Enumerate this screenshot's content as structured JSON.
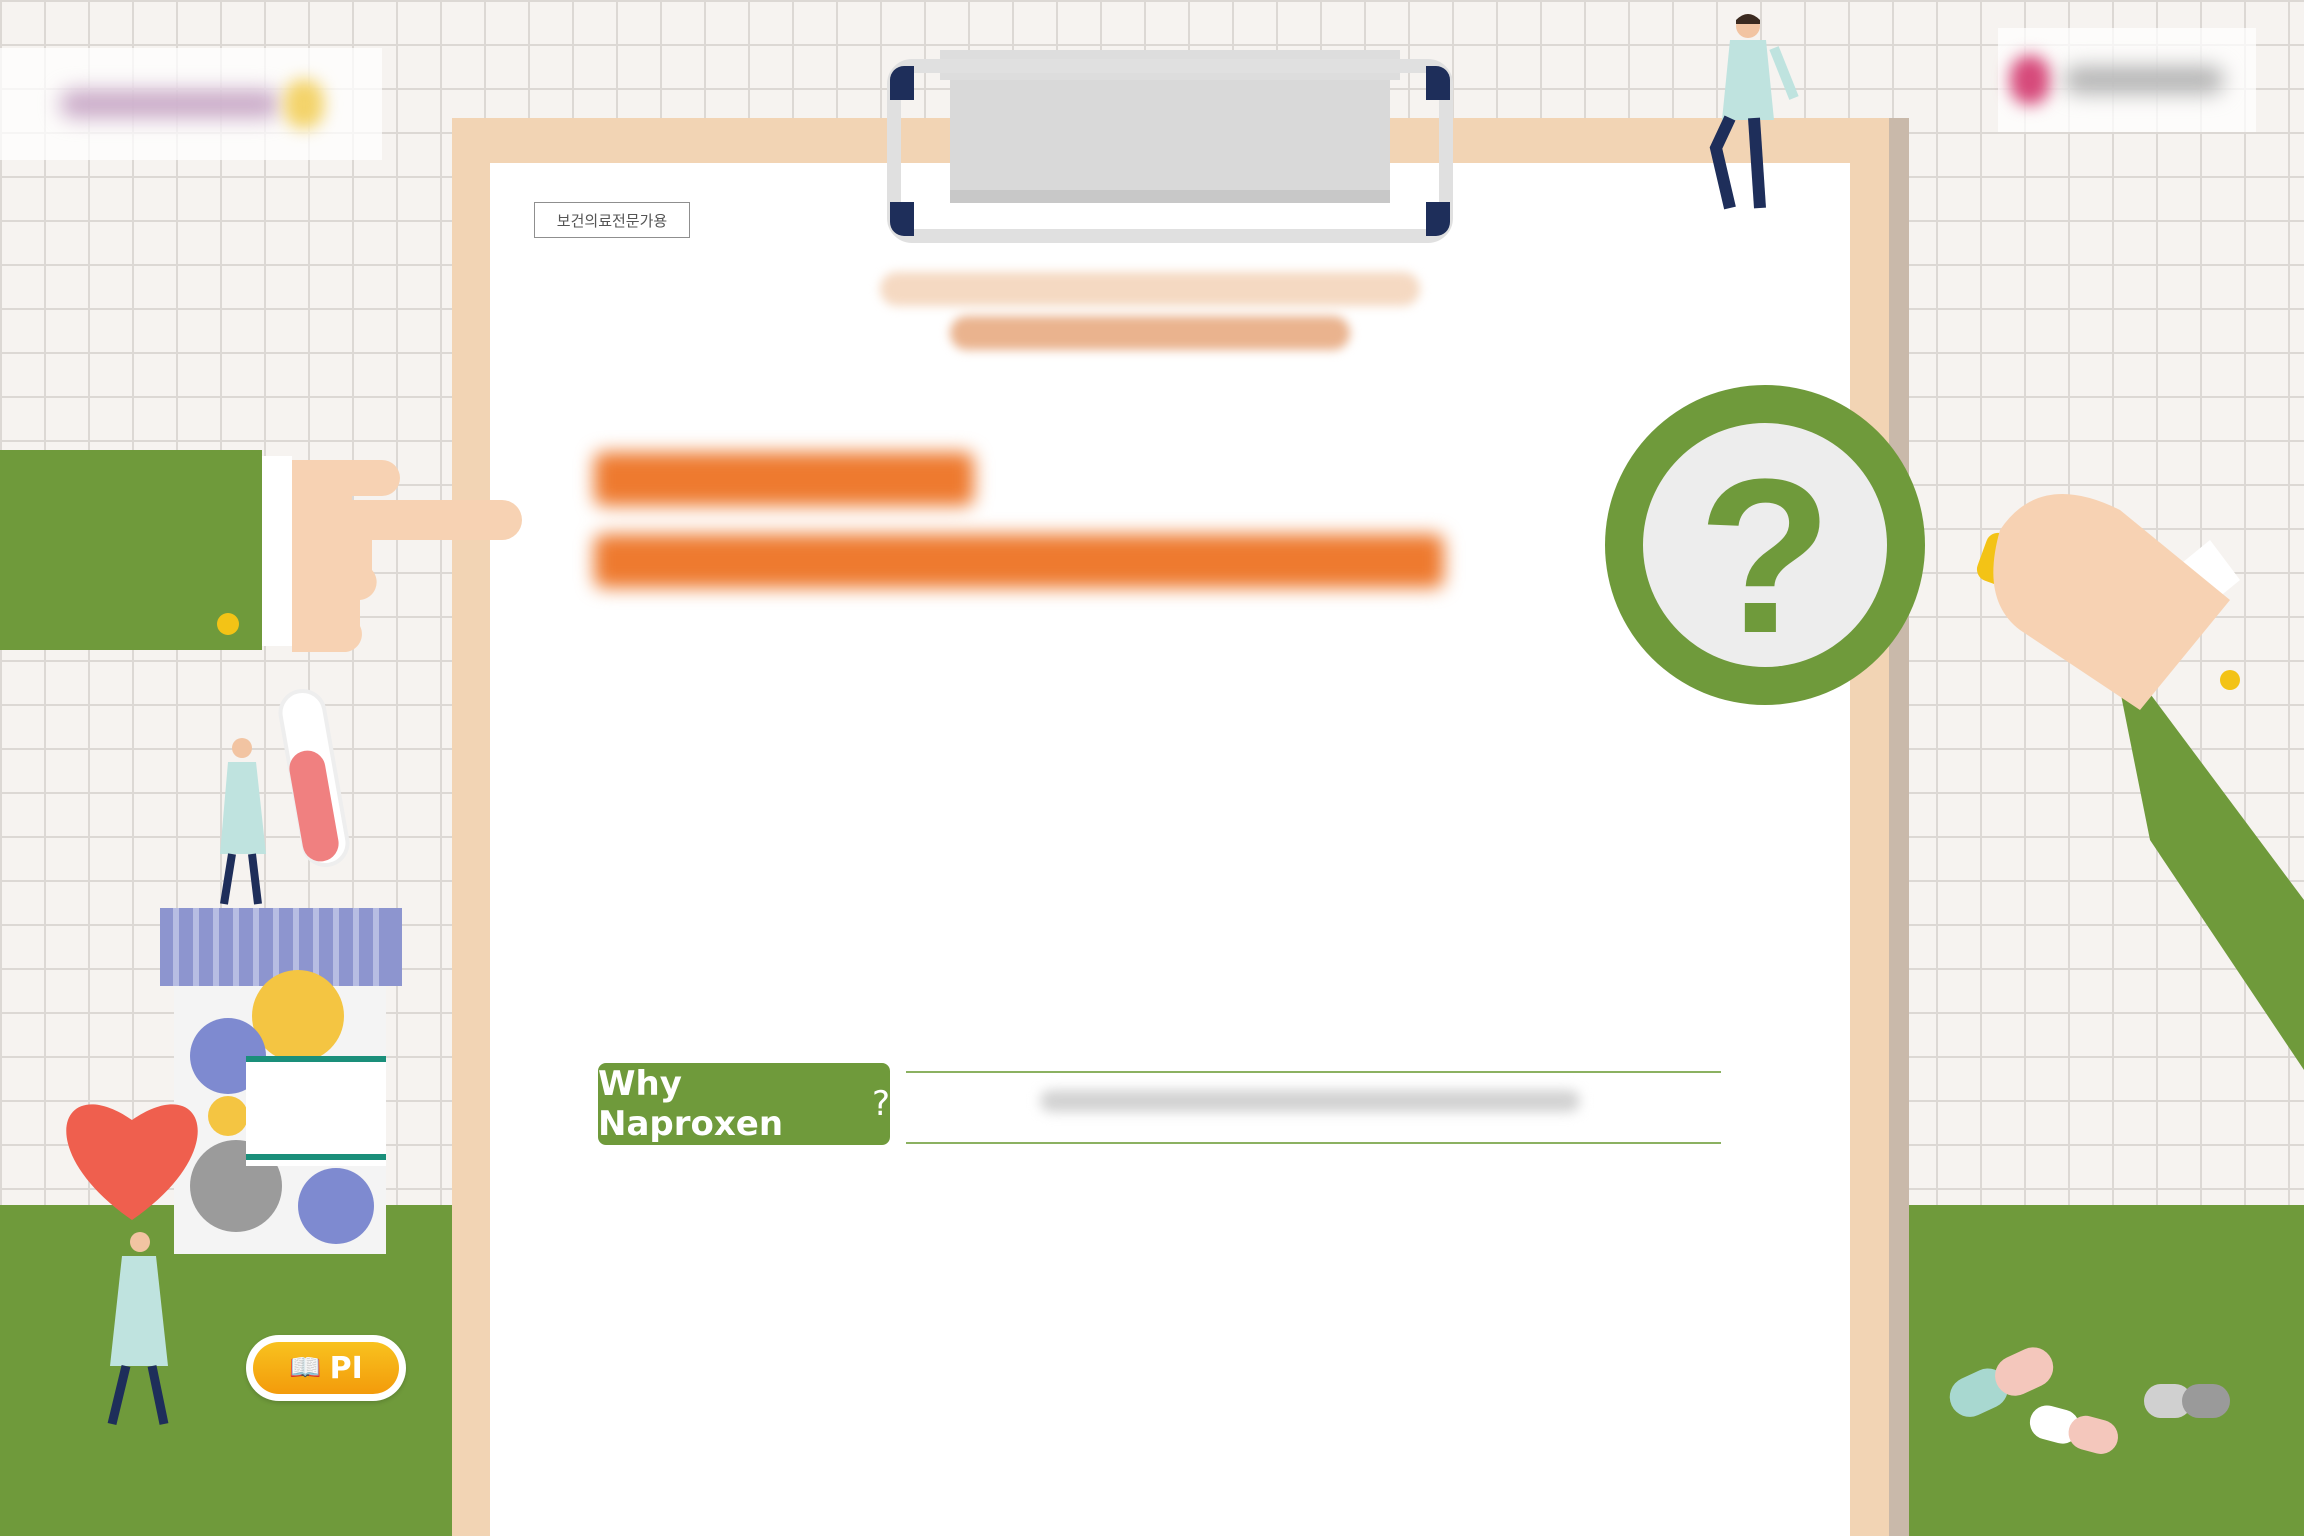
{
  "page": {
    "badge_label": "보건의료전문가용",
    "why_tag": {
      "main": "Why Naproxen",
      "mark": "?"
    },
    "pi_button": {
      "icon": "book-icon",
      "label": "PI"
    }
  },
  "colors": {
    "grass": "#6f9a3b",
    "accent_orange": "#ee7a2f",
    "clipboard": "#f2d4b4",
    "pi_yellow": "#f8c21f"
  }
}
